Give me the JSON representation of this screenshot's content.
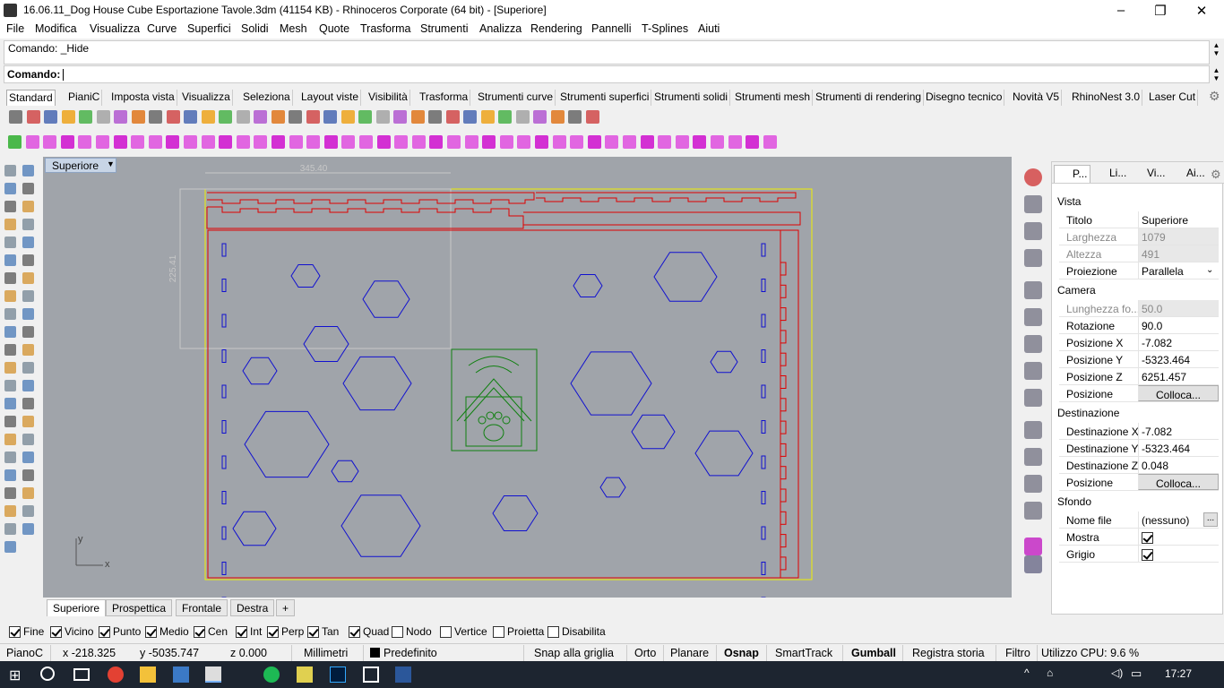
{
  "window": {
    "title": "16.06.11_Dog House Cube Esportazione Tavole.3dm (41154 KB) - Rhinoceros Corporate (64 bit) - [Superiore]",
    "buttons": [
      "–",
      "❐",
      "✕"
    ]
  },
  "menu": [
    "File",
    "Modifica",
    "Visualizza",
    "Curve",
    "Superfici",
    "Solidi",
    "Mesh",
    "Quote",
    "Trasforma",
    "Strumenti",
    "Analizza",
    "Rendering",
    "Pannelli",
    "T-Splines",
    "Aiuti"
  ],
  "command": {
    "history": "Comando: _Hide",
    "prompt_label": "Comando:"
  },
  "toolbar_tabs": [
    "Standard",
    "PianiC",
    "Imposta vista",
    "Visualizza",
    "Seleziona",
    "Layout viste",
    "Visibilità",
    "Trasforma",
    "Strumenti curve",
    "Strumenti superfici",
    "Strumenti solidi",
    "Strumenti mesh",
    "Strumenti di rendering",
    "Disegno tecnico",
    "Novità V5",
    "RhinoNest 3.0",
    "Laser Cut"
  ],
  "viewport": {
    "name": "Superiore",
    "dim_width": "345.40",
    "dim_height": "225.41",
    "axis_x": "x",
    "axis_y": "y"
  },
  "viewport_tabs": [
    "Superiore",
    "Prospettica",
    "Frontale",
    "Destra"
  ],
  "panel": {
    "tabs": [
      "P...",
      "Li...",
      "Vi...",
      "Ai..."
    ],
    "section_view": "Vista",
    "section_camera": "Camera",
    "section_target": "Destinazione",
    "section_bg": "Sfondo",
    "rows": {
      "titolo": {
        "k": "Titolo",
        "v": "Superiore"
      },
      "larghezza": {
        "k": "Larghezza",
        "v": "1079"
      },
      "altezza": {
        "k": "Altezza",
        "v": "491"
      },
      "proiezione": {
        "k": "Proiezione",
        "v": "Parallela"
      },
      "lunghezza": {
        "k": "Lunghezza fo...",
        "v": "50.0"
      },
      "rotazione": {
        "k": "Rotazione",
        "v": "90.0"
      },
      "posx": {
        "k": "Posizione X",
        "v": "-7.082"
      },
      "posy": {
        "k": "Posizione Y",
        "v": "-5323.464"
      },
      "posz": {
        "k": "Posizione Z",
        "v": "6251.457"
      },
      "posizione": {
        "k": "Posizione",
        "v": "Colloca..."
      },
      "destx": {
        "k": "Destinazione X",
        "v": "-7.082"
      },
      "desty": {
        "k": "Destinazione Y",
        "v": "-5323.464"
      },
      "destz": {
        "k": "Destinazione Z",
        "v": "0.048"
      },
      "destpos": {
        "k": "Posizione",
        "v": "Colloca..."
      },
      "nomefile": {
        "k": "Nome file",
        "v": "(nessuno)"
      },
      "mostra": {
        "k": "Mostra"
      },
      "grigio": {
        "k": "Grigio"
      }
    }
  },
  "osnaps": [
    {
      "label": "Fine",
      "on": true
    },
    {
      "label": "Vicino",
      "on": true
    },
    {
      "label": "Punto",
      "on": true
    },
    {
      "label": "Medio",
      "on": true
    },
    {
      "label": "Cen",
      "on": true
    },
    {
      "label": "Int",
      "on": true
    },
    {
      "label": "Perp",
      "on": true
    },
    {
      "label": "Tan",
      "on": true
    },
    {
      "label": "Quad",
      "on": true
    },
    {
      "label": "Nodo",
      "on": false
    },
    {
      "label": "Vertice",
      "on": false
    },
    {
      "label": "Proietta",
      "on": false
    },
    {
      "label": "Disabilita",
      "on": false
    }
  ],
  "status": {
    "cplane": "PianoC",
    "x": "x -218.325",
    "y": "y -5035.747",
    "z": "z 0.000",
    "units": "Millimetri",
    "layer": "Predefinito",
    "snap": "Snap alla griglia",
    "orto": "Orto",
    "planare": "Planare",
    "osnap": "Osnap",
    "smarttrack": "SmartTrack",
    "gumball": "Gumball",
    "history": "Registra storia",
    "filtro": "Filtro",
    "cpu": "Utilizzo CPU: 9.6 %"
  },
  "clock": "17:27",
  "colors": {
    "viewport_bg": "#a0a4aa",
    "red_curves": "#e00000",
    "blue_curves": "#1010d0",
    "green_curves": "#108010",
    "yellow_border": "#f0f000"
  }
}
